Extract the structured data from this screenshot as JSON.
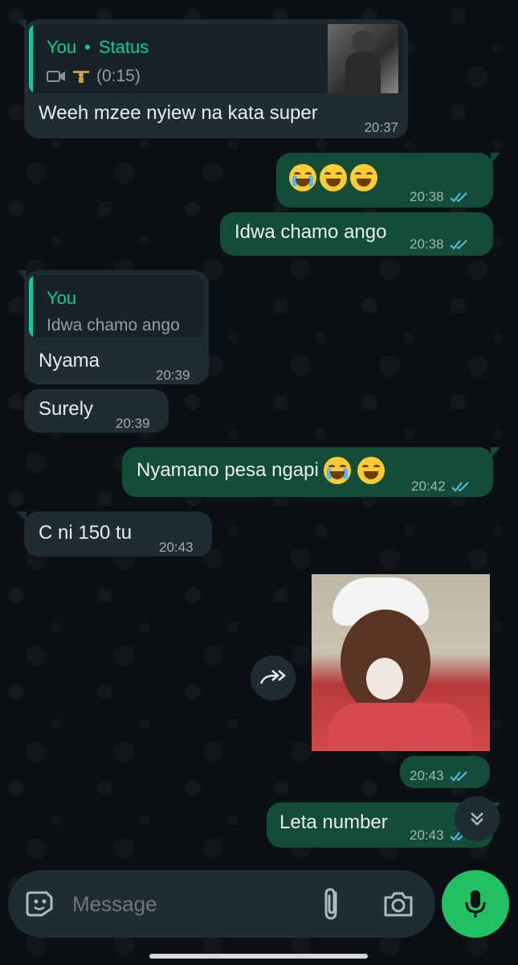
{
  "colors": {
    "background": "#0b1014",
    "incoming_bubble": "#1f2c33",
    "outgoing_bubble": "#144d37",
    "accent_green": "#06cf9c",
    "read_ticks": "#53bdeb",
    "mic_button": "#21c063"
  },
  "messages": [
    {
      "direction": "incoming",
      "quote": {
        "author": "You",
        "separator": "•",
        "label": "Status",
        "duration": "(0:15)",
        "icons": [
          "video-icon",
          "weightlifter-emoji"
        ]
      },
      "text": "Weeh mzee nyiew na kata super",
      "time": "20:37"
    },
    {
      "direction": "outgoing",
      "emojis": [
        "loudly-crying-face",
        "tears-of-joy-face",
        "tears-of-joy-face"
      ],
      "time": "20:38",
      "status": "read"
    },
    {
      "direction": "outgoing",
      "text": "Idwa chamo ango",
      "time": "20:38",
      "status": "read"
    },
    {
      "direction": "incoming",
      "quote": {
        "author": "You",
        "text": "Idwa chamo ango"
      },
      "text": "Nyama",
      "time": "20:39"
    },
    {
      "direction": "incoming",
      "text": "Surely",
      "time": "20:39"
    },
    {
      "direction": "outgoing",
      "text": "Nyamano pesa ngapi",
      "emojis": [
        "loudly-crying-face",
        "tears-of-joy-face"
      ],
      "time": "20:42",
      "status": "read"
    },
    {
      "direction": "incoming",
      "text": "C ni 150 tu",
      "time": "20:43"
    },
    {
      "direction": "outgoing",
      "sticker": "crying-child-sticker",
      "time": "20:43",
      "status": "read"
    },
    {
      "direction": "outgoing",
      "text": "Leta number",
      "time": "20:43",
      "status": "read"
    }
  ],
  "composer": {
    "placeholder": "Message",
    "icons": [
      "sticker-icon",
      "attach-icon",
      "camera-icon",
      "mic-icon"
    ]
  },
  "floating": {
    "scroll_down_icon": "double-chevron-down-icon",
    "forward_icon": "forward-icon"
  }
}
